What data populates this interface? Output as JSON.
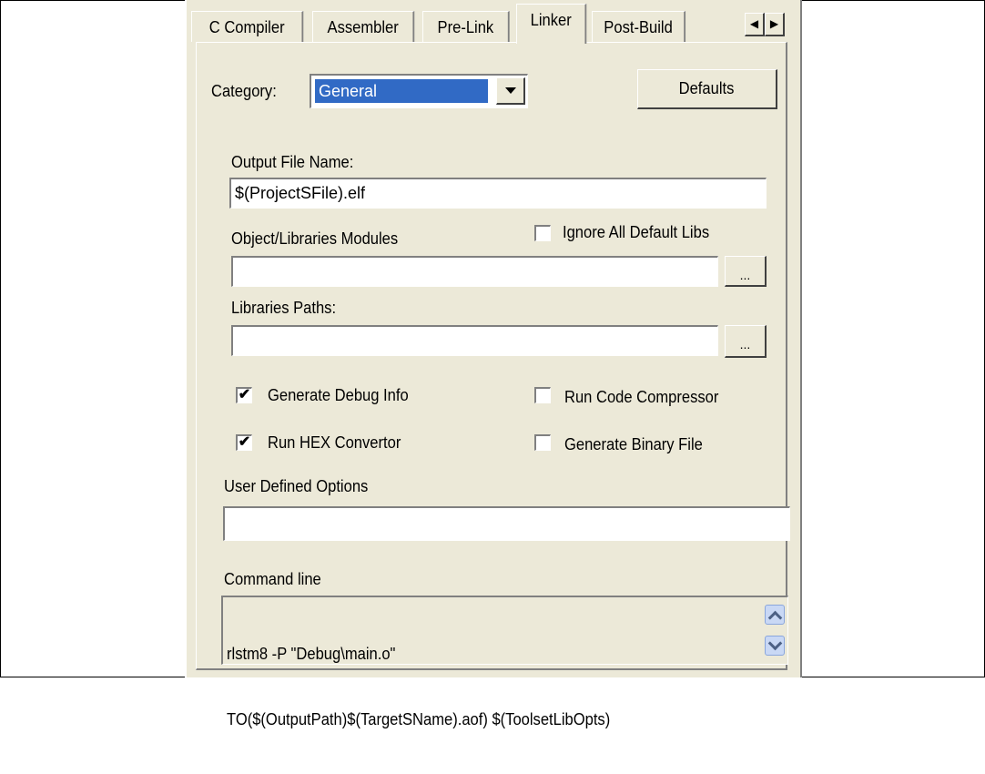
{
  "tabs": [
    "C Compiler",
    "Assembler",
    "Pre-Link",
    "Linker",
    "Post-Build"
  ],
  "active_tab": "Linker",
  "tab_scroll": {
    "left_icon": "arrow-left-icon",
    "right_icon": "arrow-right-icon",
    "left_glyph": "◀",
    "right_glyph": "▶"
  },
  "category": {
    "label": "Category:",
    "value": "General"
  },
  "defaults_button": "Defaults",
  "output_file": {
    "label": "Output File Name:",
    "value": "$(ProjectSFile).elf"
  },
  "object_modules": {
    "label": "Object/Libraries Modules",
    "value": "",
    "browse": "..."
  },
  "ignore_default_libs": {
    "label": "Ignore All Default Libs",
    "checked": false
  },
  "library_paths": {
    "label": "Libraries Paths:",
    "value": "",
    "browse": "..."
  },
  "checkboxes": {
    "debug_info": {
      "label": "Generate Debug Info",
      "checked": true,
      "mark": "✔"
    },
    "code_compressor": {
      "label": "Run Code Compressor",
      "checked": false,
      "mark": ""
    },
    "hex_convertor": {
      "label": "Run HEX Convertor",
      "checked": true,
      "mark": "✔"
    },
    "binary_file": {
      "label": "Generate Binary File",
      "checked": false,
      "mark": ""
    }
  },
  "user_options": {
    "label": "User Defined Options",
    "value": ""
  },
  "command_line": {
    "label": "Command line",
    "line1": "rlstm8 -P \"Debug\\main.o\"",
    "line2": "TO($(OutputPath)$(TargetSName).aof) $(ToolsetLibOpts)"
  },
  "colors": {
    "panel": "#ece9d8",
    "selection": "#316ac5"
  }
}
